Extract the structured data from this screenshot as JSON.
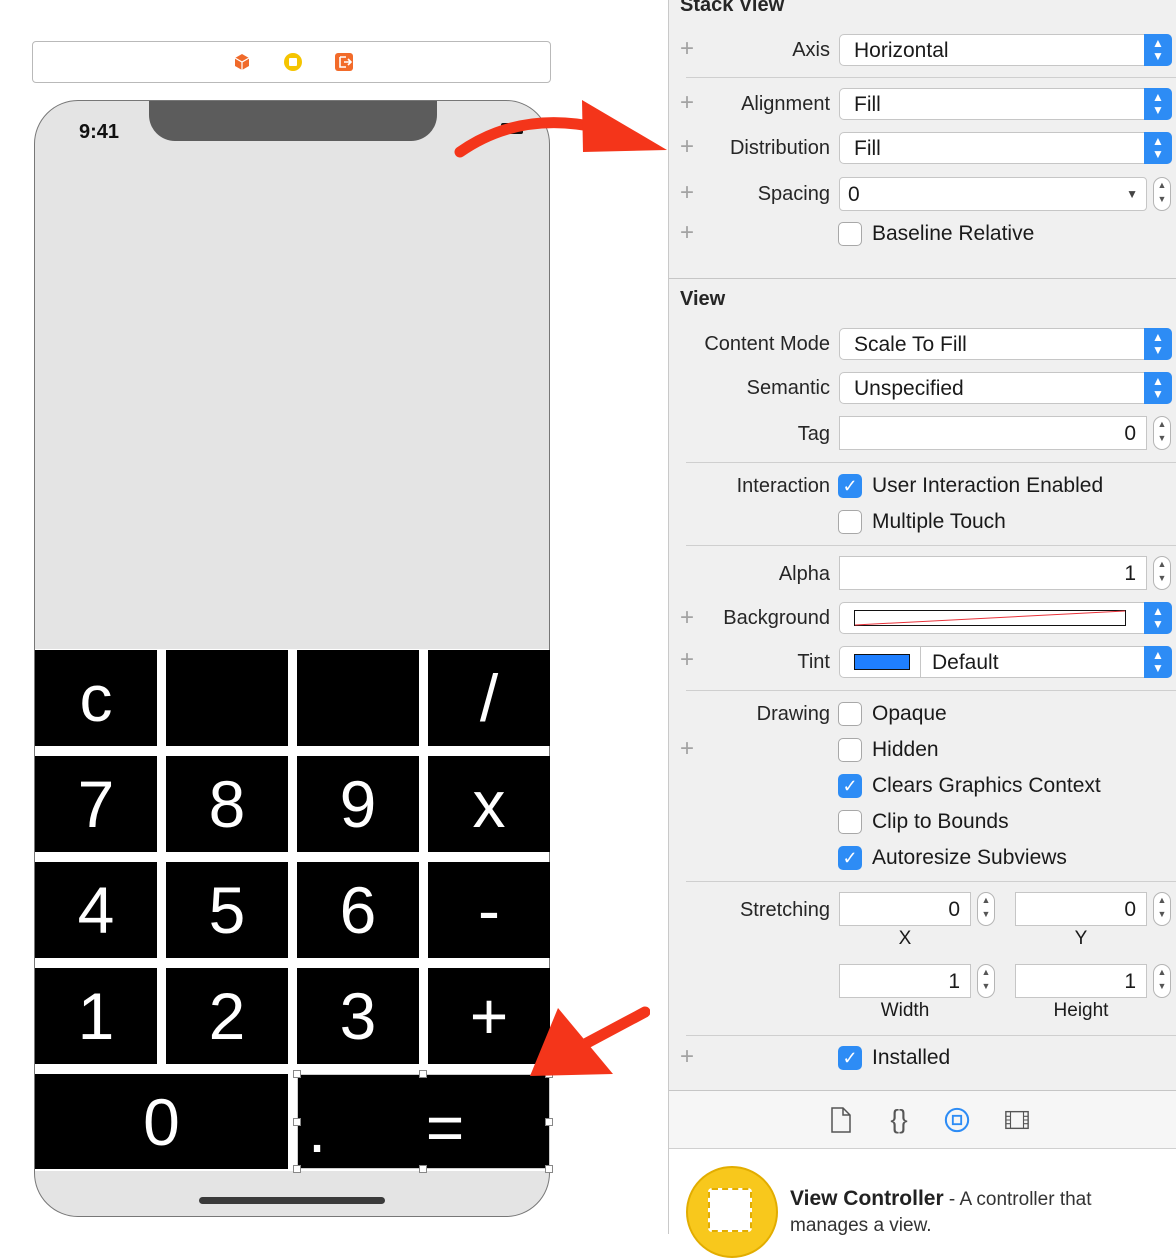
{
  "device": {
    "status_time": "9:41",
    "keypad": [
      [
        "c",
        "",
        "",
        "/"
      ],
      [
        "7",
        "8",
        "9",
        "x"
      ],
      [
        "4",
        "5",
        "6",
        "-"
      ],
      [
        "1",
        "2",
        "3",
        "+"
      ]
    ],
    "bottom_row": {
      "zero": "0",
      "dot": ".",
      "equals": "="
    }
  },
  "inspector": {
    "stack_view": {
      "title": "Stack View",
      "axis": {
        "label": "Axis",
        "value": "Horizontal"
      },
      "alignment": {
        "label": "Alignment",
        "value": "Fill"
      },
      "distribution": {
        "label": "Distribution",
        "value": "Fill"
      },
      "spacing": {
        "label": "Spacing",
        "value": "0"
      },
      "baseline_relative": {
        "label": "Baseline Relative",
        "checked": false
      }
    },
    "view": {
      "title": "View",
      "content_mode": {
        "label": "Content Mode",
        "value": "Scale To Fill"
      },
      "semantic": {
        "label": "Semantic",
        "value": "Unspecified"
      },
      "tag": {
        "label": "Tag",
        "value": "0"
      },
      "interaction": {
        "label": "Interaction",
        "user_interaction_enabled": {
          "label": "User Interaction Enabled",
          "checked": true
        },
        "multiple_touch": {
          "label": "Multiple Touch",
          "checked": false
        }
      },
      "alpha": {
        "label": "Alpha",
        "value": "1"
      },
      "background": {
        "label": "Background"
      },
      "tint": {
        "label": "Tint",
        "value": "Default",
        "swatch_color": "#1f7fff"
      },
      "drawing": {
        "label": "Drawing",
        "opaque": {
          "label": "Opaque",
          "checked": false
        },
        "hidden": {
          "label": "Hidden",
          "checked": false
        },
        "clears_graphics_context": {
          "label": "Clears Graphics Context",
          "checked": true
        },
        "clip_to_bounds": {
          "label": "Clip to Bounds",
          "checked": false
        },
        "autoresize_subviews": {
          "label": "Autoresize Subviews",
          "checked": true
        }
      },
      "stretching": {
        "label": "Stretching",
        "x": {
          "label": "X",
          "value": "0"
        },
        "y": {
          "label": "Y",
          "value": "0"
        },
        "width": {
          "label": "Width",
          "value": "1"
        },
        "height": {
          "label": "Height",
          "value": "1"
        }
      },
      "installed": {
        "label": "Installed",
        "checked": true
      }
    },
    "library_item": {
      "title": "View Controller",
      "description": " - A controller that manages a view."
    }
  },
  "colors": {
    "accent": "#2d8cf5",
    "arrow": "#f4351a",
    "inspector_bg": "#f0f0f0"
  }
}
